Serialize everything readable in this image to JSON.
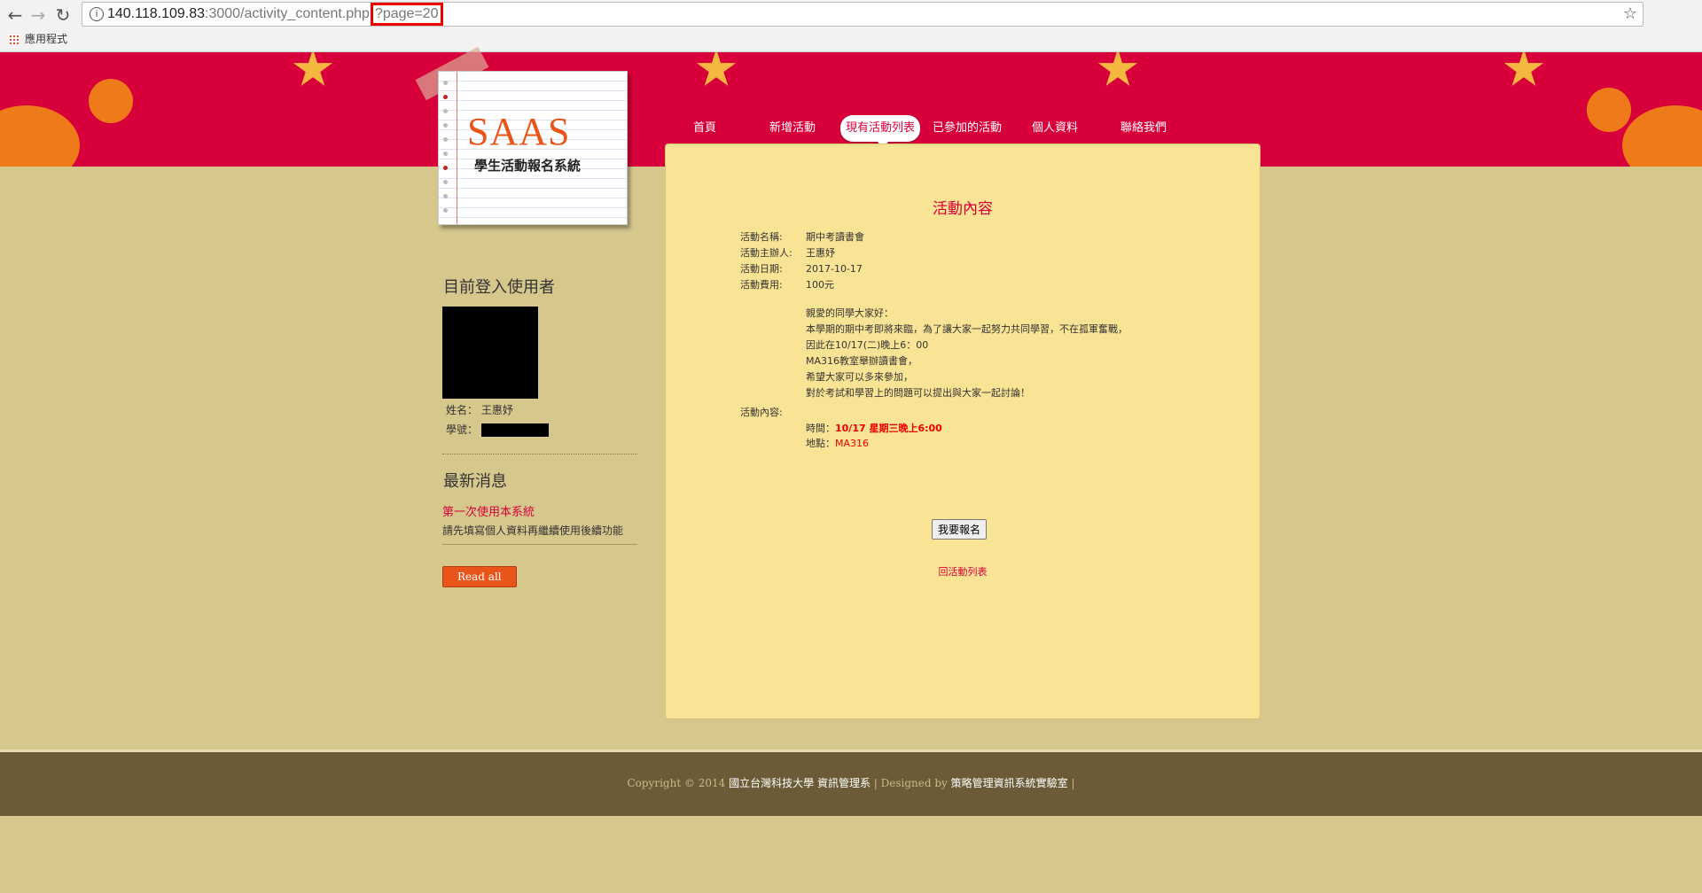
{
  "browser": {
    "url_host": "140.118.109.83",
    "url_path": ":3000/activity_content.php",
    "url_query": "?page=20",
    "bookmarks_label": "應用程式"
  },
  "logo": {
    "title": "SAAS",
    "subtitle": "學生活動報名系統"
  },
  "nav": {
    "items": [
      "首頁",
      "新增活動",
      "現有活動列表",
      "已參加的活動",
      "個人資料",
      "聯絡我們"
    ],
    "active": "現有活動列表"
  },
  "sidebar": {
    "user_heading": "目前登入使用者",
    "name_label": "姓名：",
    "name_value": "王惠妤",
    "id_label": "學號：",
    "news_heading": "最新消息",
    "news_title": "第一次使用本系統",
    "news_body": "請先填寫個人資料再繼續使用後續功能",
    "read_all": "Read all"
  },
  "activity": {
    "heading": "活動內容",
    "name_label": "活動名稱:",
    "name_value": "期中考讀書會",
    "organizer_label": "活動主辦人:",
    "organizer_value": "王惠妤",
    "date_label": "活動日期:",
    "date_value": "2017-10-17",
    "fee_label": "活動費用:",
    "fee_value": "100元",
    "content_label": "活動內容:",
    "description": [
      "親愛的同學大家好：",
      "本學期的期中考即將來臨，為了讓大家一起努力共同學習，不在孤軍奮戰，",
      "因此在10/17(二)晚上6：00",
      "MA316教室舉辦讀書會，",
      "希望大家可以多來參加，",
      "對於考試和學習上的問題可以提出與大家一起討論！"
    ],
    "time_label": "時間：",
    "time_value": "10/17 星期三晚上6:00",
    "place_label": "地點：",
    "place_value": "MA316",
    "signup_button": "我要報名",
    "back_link": "回活動列表"
  },
  "footer": {
    "copyright": "Copyright © 2014",
    "school": "國立台灣科技大學 資訊管理系",
    "sep1": " | Designed by ",
    "lab": "策略管理資訊系統實驗室",
    "sep2": " |"
  }
}
